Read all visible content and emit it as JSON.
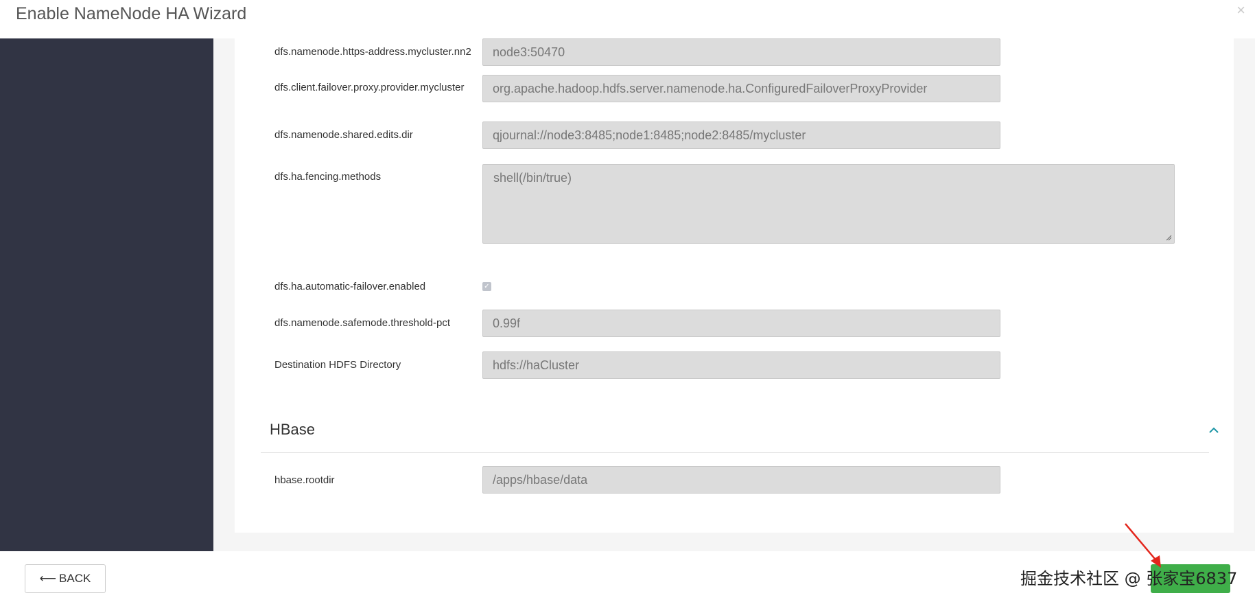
{
  "header": {
    "title": "Enable NameNode HA Wizard",
    "close_icon": "×"
  },
  "config_rows": [
    {
      "label": "dfs.namenode.https-address.mycluster.nn2",
      "value": "node3:50470"
    },
    {
      "label": "dfs.client.failover.proxy.provider.mycluster",
      "value": "org.apache.hadoop.hdfs.server.namenode.ha.ConfiguredFailoverProxyProvider"
    },
    {
      "label": "dfs.namenode.shared.edits.dir",
      "value": "qjournal://node3:8485;node1:8485;node2:8485/mycluster"
    },
    {
      "label": "dfs.ha.fencing.methods",
      "value": "shell(/bin/true)"
    },
    {
      "label": "dfs.ha.automatic-failover.enabled",
      "value": "checked"
    },
    {
      "label": "dfs.namenode.safemode.threshold-pct",
      "value": "0.99f"
    },
    {
      "label": "Destination HDFS Directory",
      "value": "hdfs://haCluster"
    }
  ],
  "hbase_section": {
    "title": "HBase",
    "rows": [
      {
        "label": "hbase.rootdir",
        "value": "/apps/hbase/data"
      }
    ]
  },
  "footer": {
    "back_label": "BACK",
    "back_icon": "⟵",
    "watermark_text": "掘金技术社区 @ 张家宝6837"
  },
  "colors": {
    "sidebar": "#313444",
    "next_button": "#3fae49",
    "annotation_arrow": "#e3251b",
    "accent": "#1b95a5"
  }
}
